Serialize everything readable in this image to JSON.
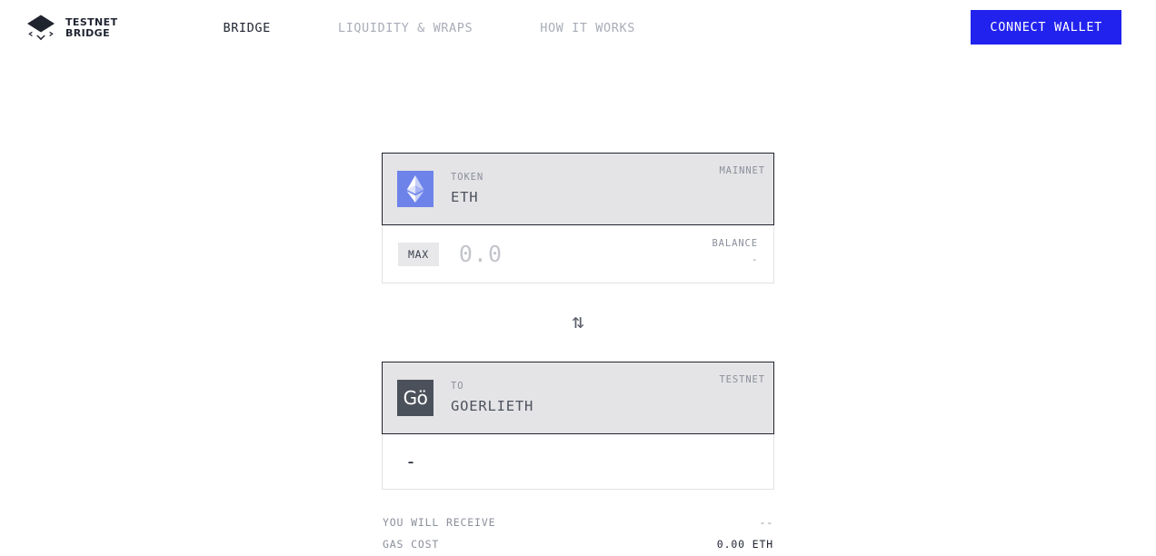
{
  "header": {
    "logo": {
      "icon": "rhombus-bridge-logo-icon",
      "line1": "TESTNET",
      "line2": "BRIDGE"
    },
    "nav": [
      {
        "label": "BRIDGE",
        "active": true
      },
      {
        "label": "LIQUIDITY & WRAPS",
        "active": false
      },
      {
        "label": "HOW IT WORKS",
        "active": false
      }
    ],
    "connect_wallet_label": "CONNECT WALLET"
  },
  "bridge": {
    "from": {
      "icon": "ethereum-icon",
      "label": "TOKEN",
      "value": "ETH",
      "network_badge": "MAINNET"
    },
    "amount": {
      "max_label": "MAX",
      "placeholder": "0.0",
      "value": "",
      "balance_label": "BALANCE",
      "balance_value": "-"
    },
    "swap_icon": "swap-vertical-icon",
    "to": {
      "icon": "goerli-icon",
      "icon_text": "Gö",
      "label": "TO",
      "value": "GOERLIETH",
      "network_badge": "TESTNET"
    },
    "receive_preview": "-",
    "summary": [
      {
        "key": "YOU WILL RECEIVE",
        "value": "--",
        "emphasis": false
      },
      {
        "key": "GAS COST",
        "value": "0.00 ETH",
        "emphasis": true
      }
    ]
  },
  "colors": {
    "accent": "#2222ee",
    "ink": "#1f2430",
    "muted": "#8b8f9b",
    "eth_tile": "#6d83ea",
    "goerli_tile": "#4b515b",
    "selector_bg": "#e4e4e6"
  }
}
